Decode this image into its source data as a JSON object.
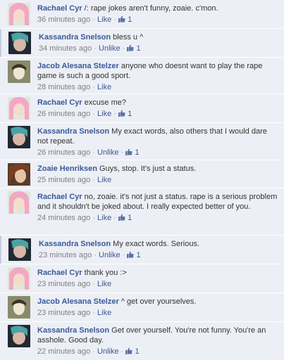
{
  "colors": {
    "link": "#3b5998",
    "row_bg": "#eceff5",
    "meta": "#808080",
    "text": "#333333"
  },
  "comments": [
    {
      "author": "Rachael Cyr",
      "text": "/: rape jokes aren't funny, zoaie. c'mon.",
      "time": "36 minutes ago",
      "dot": "·",
      "action": "Like",
      "likes": "1",
      "avatar": "pink-hair-avatar",
      "has_likes": true
    },
    {
      "author": "Kassandra Snelson",
      "text": "bless u ^",
      "time": "34 minutes ago",
      "dot": "·",
      "action": "Unlike",
      "likes": "1",
      "avatar": "dark-teal-avatar",
      "has_likes": true
    },
    {
      "author": "Jacob Alesana Stelzer",
      "text": "anyone who doesnt want to play the rape game is such a good sport.",
      "time": "28 minutes ago",
      "dot": "·",
      "action": "Like",
      "avatar": "pale-face-avatar",
      "has_likes": false
    },
    {
      "author": "Rachael Cyr",
      "text": "excuse me?",
      "time": "26 minutes ago",
      "dot": "·",
      "action": "Like",
      "likes": "1",
      "avatar": "pink-hair-avatar",
      "has_likes": true
    },
    {
      "author": "Kassandra Snelson",
      "text": "My exact words, also others that I would dare not repeat.",
      "time": "26 minutes ago",
      "dot": "·",
      "action": "Unlike",
      "likes": "1",
      "avatar": "dark-teal-avatar",
      "has_likes": true
    },
    {
      "author": "Zoaie Henriksen",
      "text": "Guys, stop. It's just a status.",
      "time": "25 minutes ago",
      "dot": "·",
      "action": "Like",
      "avatar": "brown-hair-avatar",
      "has_likes": false
    },
    {
      "author": "Rachael Cyr",
      "text": "no, zoaie. it's not just a status. rape is a serious problem and it shouldn't be joked about. I really expected better of you.",
      "time": "24 minutes ago",
      "dot": "·",
      "action": "Like",
      "likes": "1",
      "avatar": "pink-hair-avatar",
      "has_likes": true
    },
    {
      "author": "Kassandra Snelson",
      "text": "My exact words. Serious.",
      "time": "23 minutes ago",
      "dot": "·",
      "action": "Unlike",
      "likes": "1",
      "avatar": "dark-teal-avatar",
      "has_likes": true
    },
    {
      "author": "Rachael Cyr",
      "text": "thank you :>",
      "time": "23 minutes ago",
      "dot": "·",
      "action": "Like",
      "avatar": "pink-hair-avatar",
      "has_likes": false
    },
    {
      "author": "Jacob Alesana Stelzer",
      "text": "^ get over yourselves.",
      "time": "23 minutes ago",
      "dot": "·",
      "action": "Like",
      "avatar": "pale-face-avatar",
      "has_likes": false
    },
    {
      "author": "Kassandra Snelson",
      "text": "Get over yourself. You're not funny. You're an asshole. Good day.",
      "time": "22 minutes ago",
      "dot": "·",
      "action": "Unlike",
      "likes": "1",
      "avatar": "dark-teal-avatar",
      "has_likes": true
    }
  ]
}
